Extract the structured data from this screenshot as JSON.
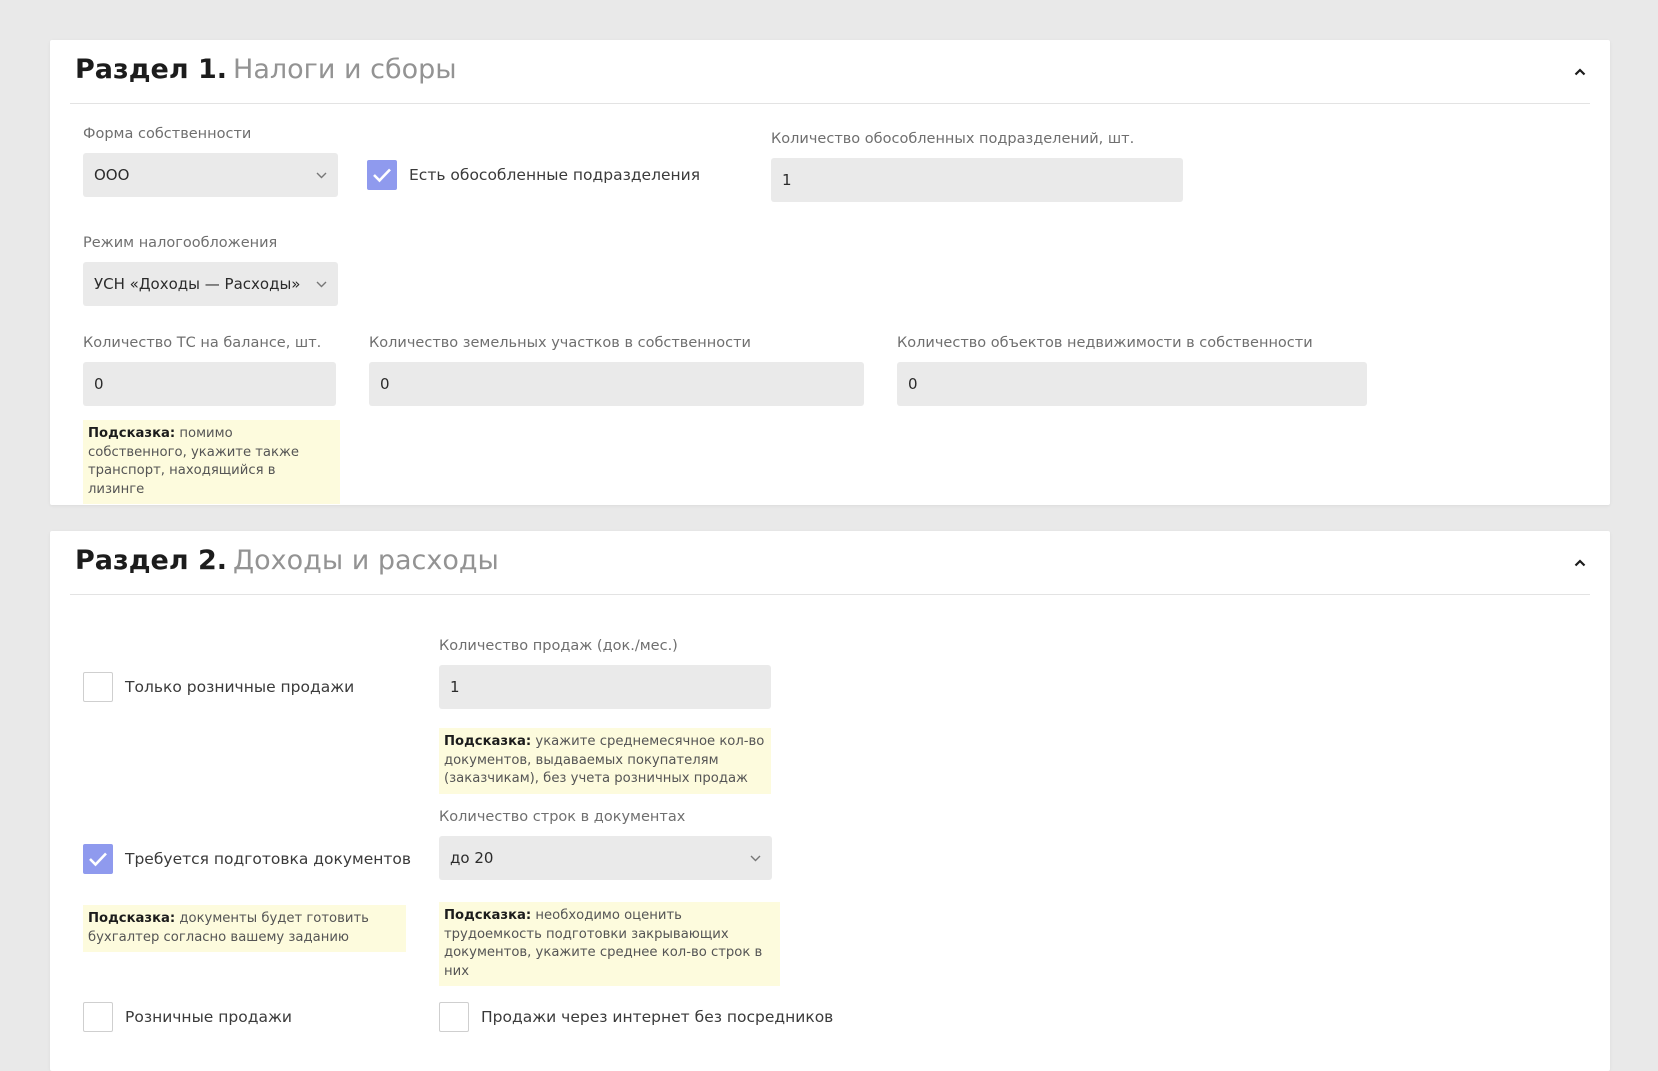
{
  "section1": {
    "title": "Раздел 1.",
    "subtitle": "Налоги и сборы",
    "ownership_label": "Форма собственности",
    "ownership_value": "ООО",
    "branches_checkbox_label": "Есть обособленные подразделения",
    "branches_checked": true,
    "branches_count_label": "Количество обособленных подразделений, шт.",
    "branches_count_value": "1",
    "tax_regime_label": "Режим налогообложения",
    "tax_regime_value": "УСН «Доходы — Расходы»",
    "vehicles_label": "Количество ТС на балансе, шт.",
    "vehicles_value": "0",
    "land_label": "Количество земельных участков в собственности",
    "land_value": "0",
    "realty_label": "Количество объектов недвижимости в собственности",
    "realty_value": "0",
    "hint_vehicles_title": "Подсказка:",
    "hint_vehicles_text": "помимо собственного, укажите также транспорт, находящийся в лизинге"
  },
  "section2": {
    "title": "Раздел 2.",
    "subtitle": "Доходы и расходы",
    "retail_only_label": "Только розничные продажи",
    "retail_only_checked": false,
    "sales_count_label": "Количество продаж (док./мес.)",
    "sales_count_value": "1",
    "hint_sales_title": "Подсказка:",
    "hint_sales_text": "укажите среднемесячное кол-во документов, выдаваемых покупателям (заказчикам), без учета розничных продаж",
    "doc_lines_label": "Количество строк в документах",
    "doc_lines_value": "до 20",
    "docs_prep_label": "Требуется подготовка документов",
    "docs_prep_checked": true,
    "hint_docs_title": "Подсказка:",
    "hint_docs_text": "документы будет готовить бухгалтер согласно вашему заданию",
    "hint_lines_title": "Подсказка:",
    "hint_lines_text": "необходимо оценить трудоемкость подготовки закрывающих документов, укажите среднее кол-во строк в них",
    "retail_label": "Розничные продажи",
    "retail_checked": false,
    "online_label": "Продажи через интернет без посредников",
    "online_checked": false
  },
  "colors": {
    "page_bg": "#e9e9e9",
    "card_bg": "#ffffff",
    "field_bg": "#eaeaea",
    "checkbox_accent": "#8f9aee",
    "hint_bg": "#fdfbdd",
    "subtitle_gray": "#939393"
  },
  "icons": [
    "chevron-up-icon",
    "chevron-down-icon",
    "checkmark-icon"
  ]
}
